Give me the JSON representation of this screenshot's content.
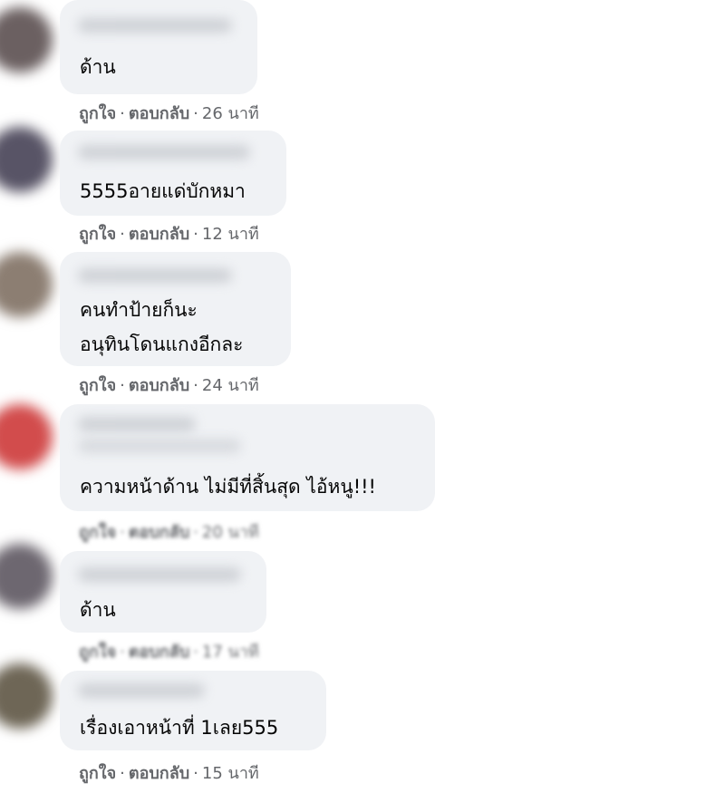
{
  "actions": {
    "like": "ถูกใจ",
    "reply": "ตอบกลับ",
    "separator": "·"
  },
  "comments": [
    {
      "text": "ด้าน",
      "time": "26 นาที",
      "avatar_color": "#6b6061"
    },
    {
      "text": "5555อายแด่บักหมา",
      "time": "12 นาที",
      "avatar_color": "#585466"
    },
    {
      "text": "คนทำป้ายก็นะ\nอนุทินโดนแกงอีกละ",
      "time": "24 นาที",
      "avatar_color": "#8c7e72"
    },
    {
      "text": "ความหน้าด้าน ไม่มีที่สิ้นสุด ไอ้หนู!!!",
      "time": "20 นาที",
      "avatar_color": "#d24c4c"
    },
    {
      "text": "ด้าน",
      "time": "17 นาที",
      "avatar_color": "#6d6770"
    },
    {
      "text": "เรื่องเอาหน้าที่ 1เลย555",
      "time": "15 นาที",
      "avatar_color": "#6e6656"
    }
  ]
}
